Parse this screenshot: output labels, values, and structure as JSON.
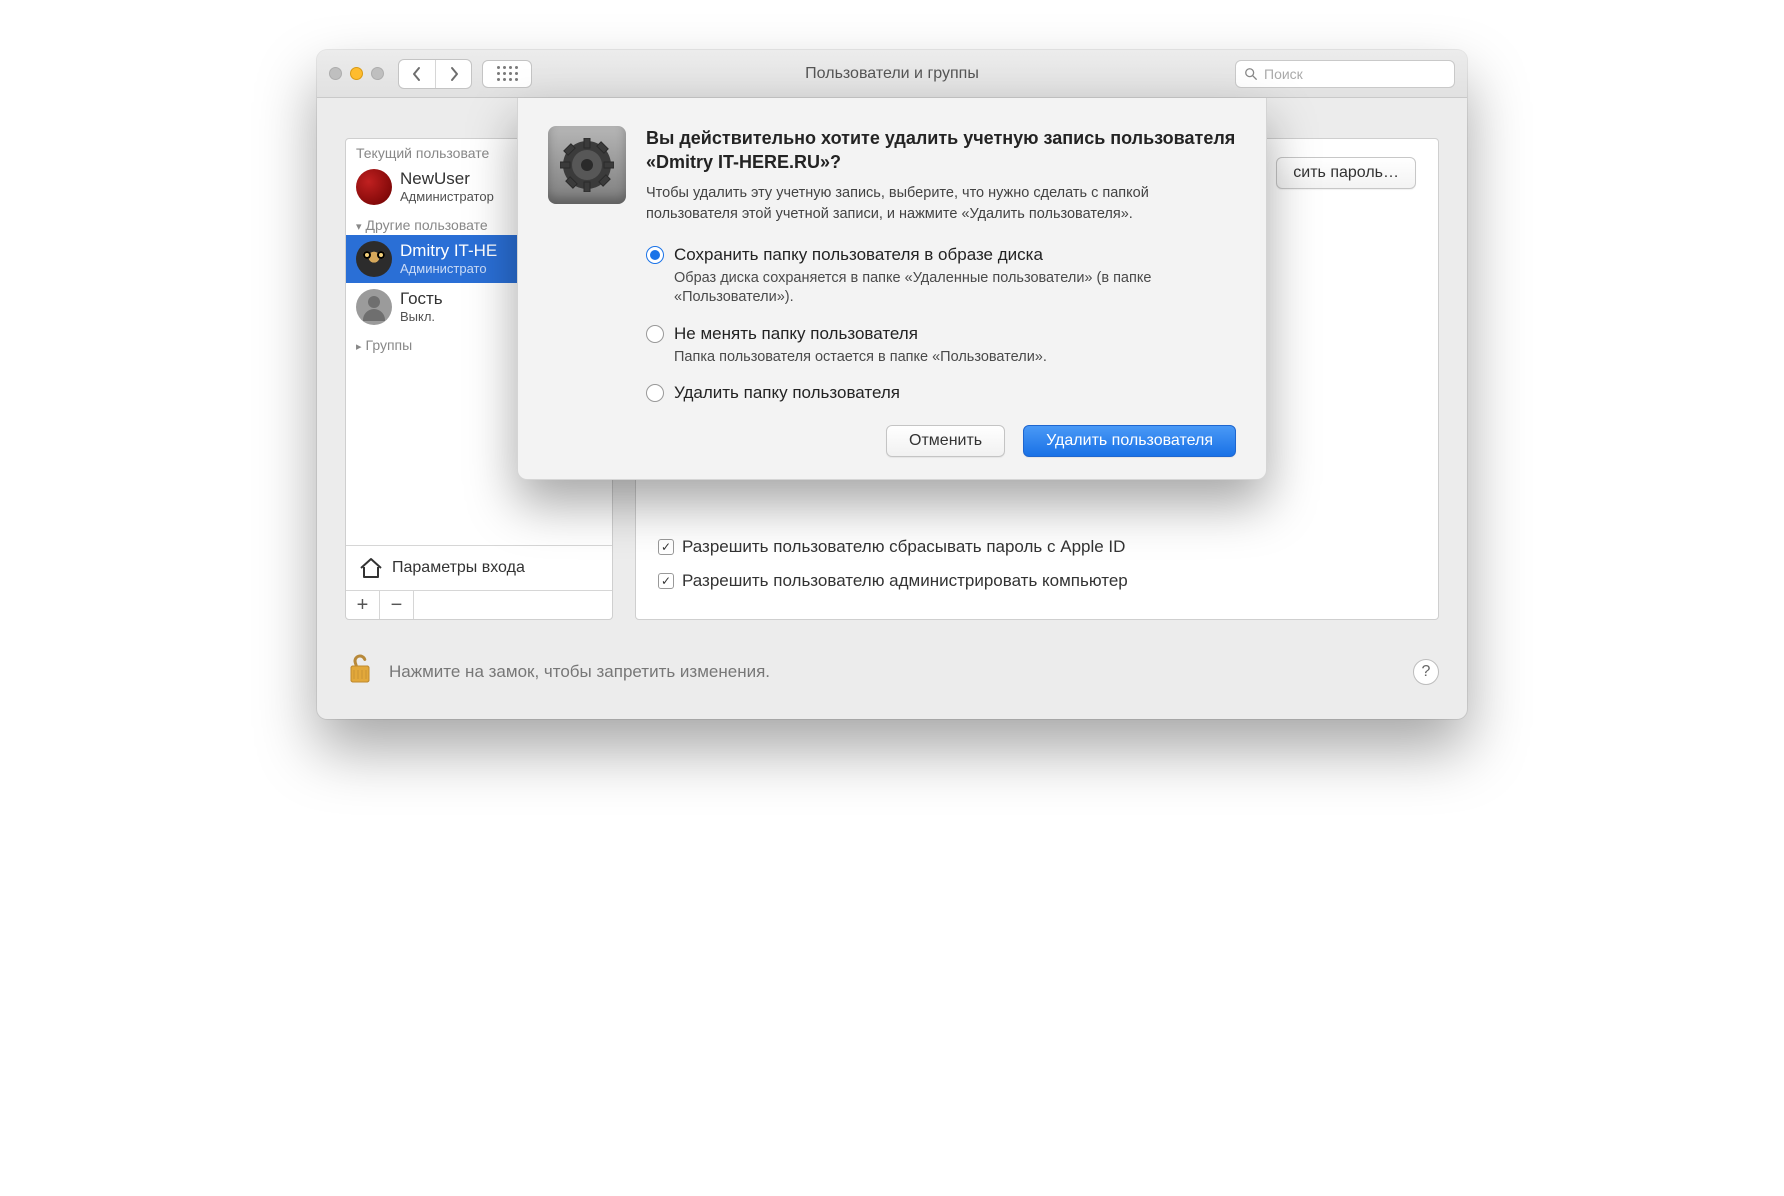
{
  "titlebar": {
    "title": "Пользователи и группы",
    "search_placeholder": "Поиск"
  },
  "sidebar": {
    "current_user_header": "Текущий пользовате",
    "other_users_header": "Другие пользовате",
    "groups_header": "Группы",
    "login_params": "Параметры входа",
    "users": [
      {
        "name": "NewUser",
        "role": "Администратор"
      },
      {
        "name": "Dmitry IT-HE",
        "role": "Администрато"
      },
      {
        "name": "Гость",
        "role": "Выкл."
      }
    ]
  },
  "main": {
    "reset_password": "сить пароль…",
    "check_reset_appleid": "Разрешить пользователю сбрасывать пароль с Apple ID",
    "check_admin": "Разрешить пользователю администрировать компьютер"
  },
  "footer": {
    "lock_text": "Нажмите на замок, чтобы запретить изменения.",
    "help": "?"
  },
  "modal": {
    "title": "Вы действительно хотите удалить учетную запись пользователя «Dmitry IT-HERE.RU»?",
    "subtitle": "Чтобы удалить эту учетную запись, выберите, что нужно сделать с папкой пользователя этой учетной записи, и нажмите «Удалить пользователя».",
    "options": [
      {
        "label": "Сохранить папку пользователя в образе диска",
        "desc": "Образ диска сохраняется в папке «Удаленные пользователи» (в папке «Пользователи»)."
      },
      {
        "label": "Не менять папку пользователя",
        "desc": "Папка пользователя остается в папке «Пользователи»."
      },
      {
        "label": "Удалить папку пользователя",
        "desc": ""
      }
    ],
    "cancel": "Отменить",
    "delete": "Удалить пользователя"
  }
}
